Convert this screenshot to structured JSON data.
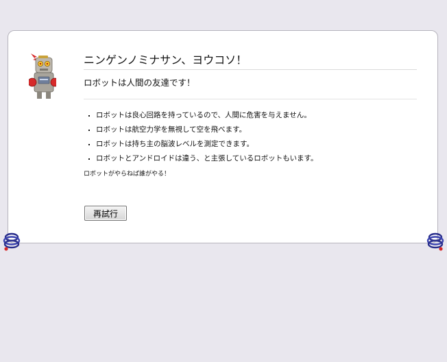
{
  "error": {
    "title": "ニンゲンノミナサン、ヨウコソ！",
    "subtitle": "ロボットは人間の友達です！",
    "bullets": [
      "ロボットは良心回路を持っているので、人間に危害を与えません。",
      "ロボットは航空力学を無視して空を飛べます。",
      "ロボットは持ち主の脳波レベルを測定できます。",
      "ロボットとアンドロイドは違う、と主張しているロボットもいます。"
    ],
    "footnote": "ロボットがやらねば誰がやる！",
    "retry_label": "再試行"
  },
  "icons": {
    "illustration": "robot-icon",
    "corner_decoration": "spring-icon"
  },
  "colors": {
    "background": "#e9e7ee",
    "panel": "#ffffff",
    "panel_border": "#b5b3bc",
    "robot_red": "#d62a2a",
    "robot_body": "#b9b6ad",
    "spring_blue": "#2a2f8c"
  }
}
